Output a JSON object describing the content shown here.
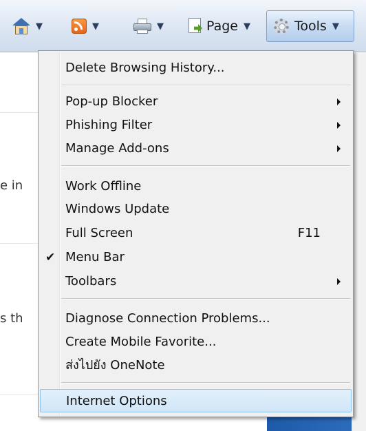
{
  "toolbar": {
    "page_label": "Page",
    "tools_label": "Tools"
  },
  "background": {
    "text1": "e in",
    "text2": "s th"
  },
  "menu": {
    "delete_history": "Delete Browsing History...",
    "popup_blocker": "Pop-up Blocker",
    "phishing_filter": "Phishing Filter",
    "manage_addons": "Manage Add-ons",
    "work_offline": "Work Offline",
    "windows_update": "Windows Update",
    "full_screen": "Full Screen",
    "full_screen_shortcut": "F11",
    "menu_bar": "Menu Bar",
    "menu_bar_checked": true,
    "toolbars": "Toolbars",
    "diagnose": "Diagnose Connection Problems...",
    "mobile_favorite": "Create Mobile Favorite...",
    "onenote": "ส่งไปยัง OneNote",
    "internet_options": "Internet Options"
  }
}
